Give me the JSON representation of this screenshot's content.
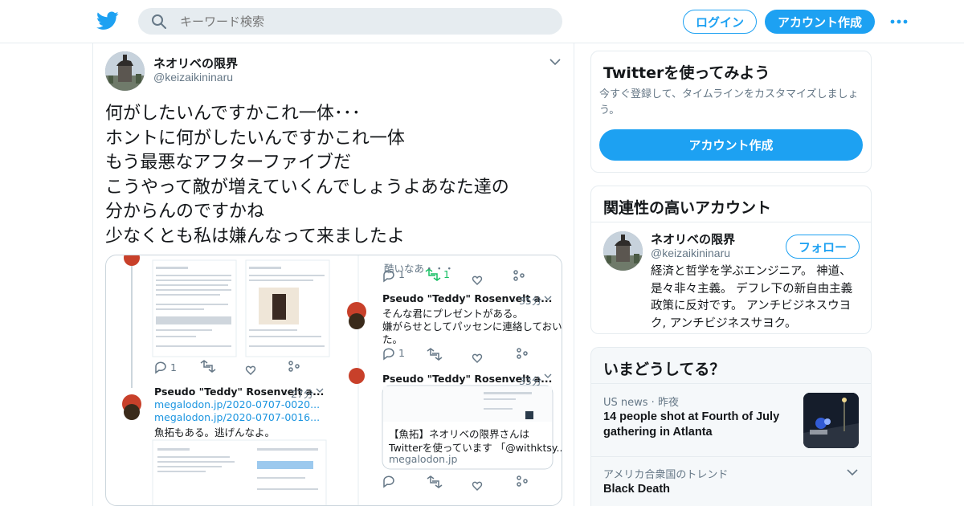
{
  "header": {
    "search_placeholder": "キーワード検索",
    "login_label": "ログイン",
    "signup_label": "アカウント作成"
  },
  "tweet": {
    "name": "ネオリベの限界",
    "handle": "@keizaikininaru",
    "lines": [
      "何がしたいんですかこれ一体･･･",
      "ホントに何がしたいんですかこれ一体",
      "もう最悪なアフターファイブだ",
      "こうやって敵が増えていくんでしょうよあなた達の",
      "分からんのですかね",
      "少なくとも私は嫌んなって来ましたよ"
    ],
    "media": {
      "top_fragment": "酷いなあ・・・",
      "counts_reply": "1",
      "counts_retweet": "1",
      "p1_name": "Pseudo \"Teddy\" Rosenvelt a...",
      "p1_time": "· 35分",
      "p1_text1": "そんな君にプレゼントがある。",
      "p1_text2": "嫌がらせとしてパッセンに連絡しておい",
      "p1_text3": "た。",
      "p1_reply": "1",
      "p2_name": "Pseudo \"Teddy\" Rosenvelt a...",
      "p2_time": "· 33分",
      "p2_card1": "【魚拓】ネオリベの限界さんは",
      "p2_card2": "Twitterを使っています 「@withktsy...",
      "p2_card3": "megalodon.jp",
      "p3_name": "Pseudo \"Teddy\" Rosenvelt a...",
      "p3_time": "· 27分",
      "p3_link1": "megalodon.jp/2020-0707-0020...",
      "p3_link2": "megalodon.jp/2020-0707-0016...",
      "p3_text": "魚拓もある。逃げんなよ。",
      "left_reply": "1"
    }
  },
  "sidebar": {
    "try": {
      "title": "Twitterを使ってみよう",
      "desc": "今すぐ登録して、タイムラインをカスタマイズしましょう。",
      "cta": "アカウント作成"
    },
    "related": {
      "title": "関連性の高いアカウント",
      "name": "ネオリベの限界",
      "handle": "@keizaikininaru",
      "follow": "フォロー",
      "bio": "経済と哲学を学ぶエンジニア。 神道、是々非々主義。 デフレ下の新自由主義政策に反対です。 アンチビジネスウヨク, アンチビジネスサヨク。"
    },
    "trends": {
      "title": "いまどうしてる？",
      "t1_meta": "US news · 昨夜",
      "t1_title": "14 people shot at Fourth of July gathering in Atlanta",
      "t2_meta": "アメリカ合衆国のトレンド",
      "t2_title": "Black Death"
    }
  },
  "colors": {
    "accent": "#1da1f2",
    "border": "#e6ecf0",
    "muted": "#657786"
  }
}
